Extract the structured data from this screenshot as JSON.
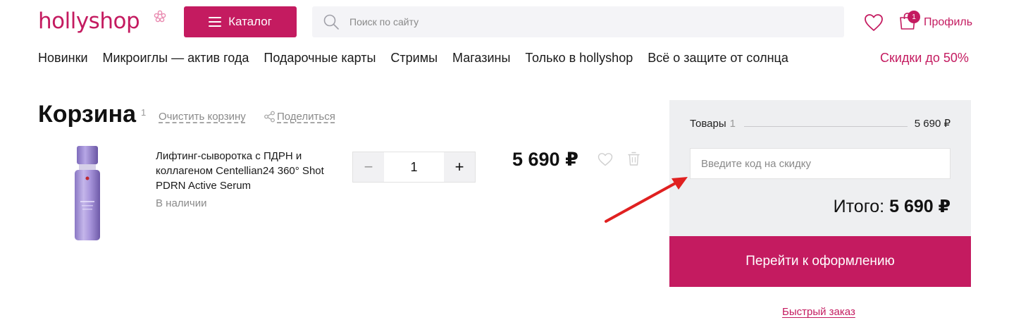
{
  "header": {
    "logo": "hollyshop",
    "catalog_label": "Каталог",
    "search_placeholder": "Поиск по сайту",
    "cart_badge": "1",
    "profile_label": "Профиль"
  },
  "nav": {
    "items": [
      "Новинки",
      "Микроиглы — актив года",
      "Подарочные карты",
      "Стримы",
      "Магазины",
      "Только в hollyshop",
      "Всё о защите от солнца"
    ],
    "sale_label": "Скидки до 50%"
  },
  "cart": {
    "title": "Корзина",
    "count": "1",
    "clear_label": "Очистить корзину",
    "share_label": "Поделиться"
  },
  "product": {
    "name": "Лифтинг-сыворотка с ПДРН и коллагеном Centellian24 360° Shot PDRN Active Serum",
    "stock": "В наличии",
    "quantity": "1",
    "minus_label": "−",
    "plus_label": "+",
    "price": "5 690 ₽"
  },
  "summary": {
    "goods_label": "Товары",
    "goods_count": "1",
    "goods_sum": "5 690 ₽",
    "promo_placeholder": "Введите код на скидку",
    "total_label": "Итого:",
    "total_value": "5 690 ₽",
    "checkout_label": "Перейти к оформлению",
    "quick_order_label": "Быстрый заказ"
  },
  "colors": {
    "brand": "#c41b60",
    "panel": "#eeeff1",
    "annotation_arrow": "#e02020"
  }
}
